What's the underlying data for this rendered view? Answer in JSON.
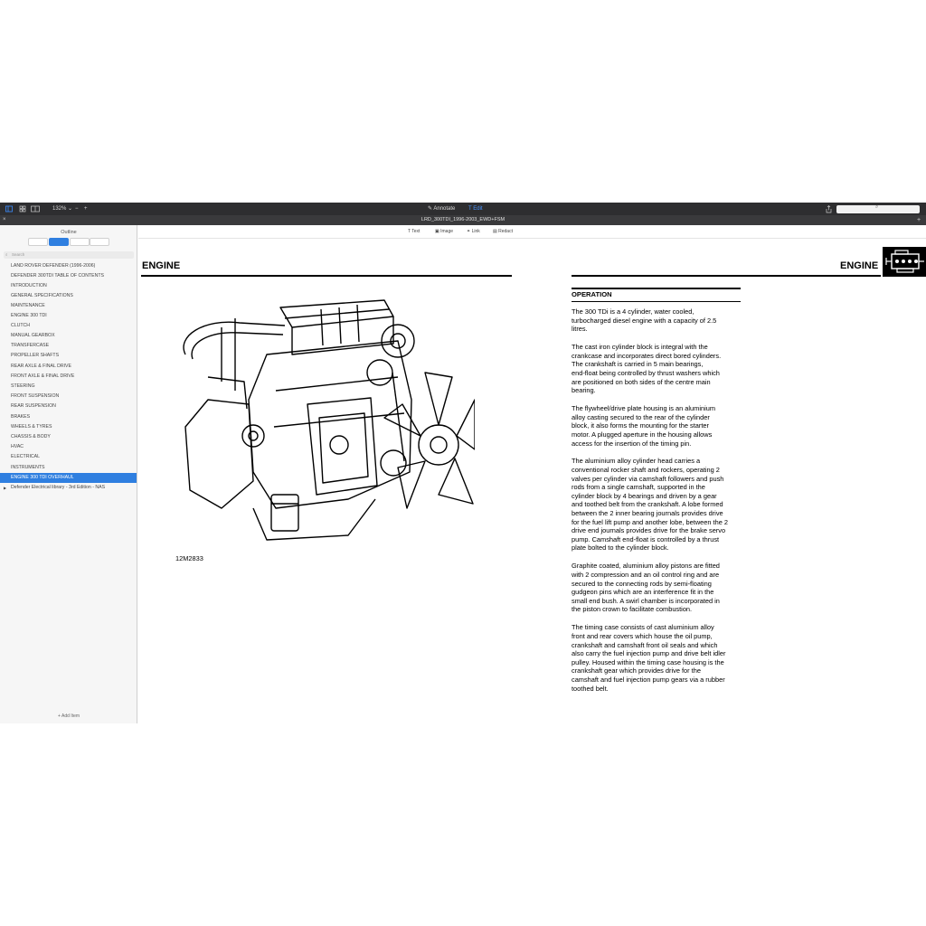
{
  "toolbar": {
    "zoom": "132%",
    "annotate_label": "Annotate",
    "edit_label": "Edit"
  },
  "window": {
    "title": "LRD_300TDI_1996-2003_EWD+FSM"
  },
  "sidebar": {
    "title": "Outline",
    "search_placeholder": "Search",
    "items": [
      {
        "label": "LAND ROVER DEFENDER (1996-2006)"
      },
      {
        "label": "DEFENDER 300TDI TABLE OF CONTENTS"
      },
      {
        "label": "INTRODUCTION"
      },
      {
        "label": "GENERAL SPECIFICATIONS"
      },
      {
        "label": "MAINTENANCE"
      },
      {
        "label": "ENGINE 300 TDI"
      },
      {
        "label": "CLUTCH"
      },
      {
        "label": "MANUAL GEARBOX"
      },
      {
        "label": "TRANSFERCASE"
      },
      {
        "label": "PROPELLER SHAFTS"
      },
      {
        "label": "REAR AXLE & FINAL DRIVE"
      },
      {
        "label": "FRONT AXLE & FINAL DRIVE"
      },
      {
        "label": "STEERING"
      },
      {
        "label": "FRONT SUSPENSION"
      },
      {
        "label": "REAR SUSPENSION"
      },
      {
        "label": "BRAKES"
      },
      {
        "label": "WHEELS & TYRES"
      },
      {
        "label": "CHASSIS & BODY"
      },
      {
        "label": "HVAC"
      },
      {
        "label": "ELECTRICAL"
      },
      {
        "label": "INSTRUMENTS"
      },
      {
        "label": "ENGINE 300 TDI OVERHAUL",
        "selected": true
      },
      {
        "label": "Defender Electrical library - 3rd Edition - NAS"
      }
    ],
    "add_item_label": "Add Item"
  },
  "edit_bar": {
    "text_label": "Text",
    "image_label": "Image",
    "link_label": "Link",
    "redact_label": "Redact"
  },
  "page": {
    "left_title": "ENGINE",
    "right_title": "ENGINE",
    "figure_caption": "12M2833",
    "section_heading": "OPERATION",
    "paragraphs": [
      [
        "The 300 TDi is a 4 cylinder, water cooled,",
        "turbocharged diesel engine with a capacity of 2.5",
        "litres."
      ],
      [
        "The cast iron cylinder block is integral with the",
        "crankcase and incorporates direct bored cylinders.",
        "The crankshaft is carried in 5 main bearings,",
        "end-float being controlled by thrust washers which",
        "are positioned on both sides of the centre main",
        "bearing."
      ],
      [
        "The flywheel/drive plate housing is an aluminium",
        "alloy casting secured to the rear of the cylinder",
        "block, it also forms the mounting for the starter",
        "motor. A plugged aperture in the housing allows",
        "access for the insertion of the timing pin."
      ],
      [
        "The aluminium alloy cylinder head carries a",
        "conventional rocker shaft and rockers, operating 2",
        "valves per cylinder via camshaft followers and push",
        "rods from a single camshaft, supported in the",
        "cylinder block by 4 bearings and driven by a gear",
        "and toothed belt from the crankshaft. A lobe formed",
        "between the 2 inner bearing journals provides drive",
        "for the fuel lift pump and another lobe, between the 2",
        "drive end journals provides drive for the brake servo",
        "pump. Camshaft end-float is controlled by a thrust",
        "plate bolted to the cylinder block."
      ],
      [
        "Graphite coated, aluminium alloy pistons are fitted",
        "with 2 compression and an oil control ring and are",
        "secured to the connecting rods by semi-floating",
        "gudgeon pins which are an interference fit in the",
        "small end bush. A swirl chamber is incorporated in",
        "the piston crown to facilitate combustion."
      ],
      [
        "The timing case consists of cast aluminium alloy",
        "front and rear covers which house the oil pump,",
        "crankshaft and camshaft front oil seals and which",
        "also carry the fuel injection pump and drive belt idler",
        "pulley. Housed within the timing case housing is the",
        "crankshaft gear which provides drive for the",
        "camshaft and fuel injection pump gears via a rubber",
        "toothed belt."
      ]
    ]
  }
}
